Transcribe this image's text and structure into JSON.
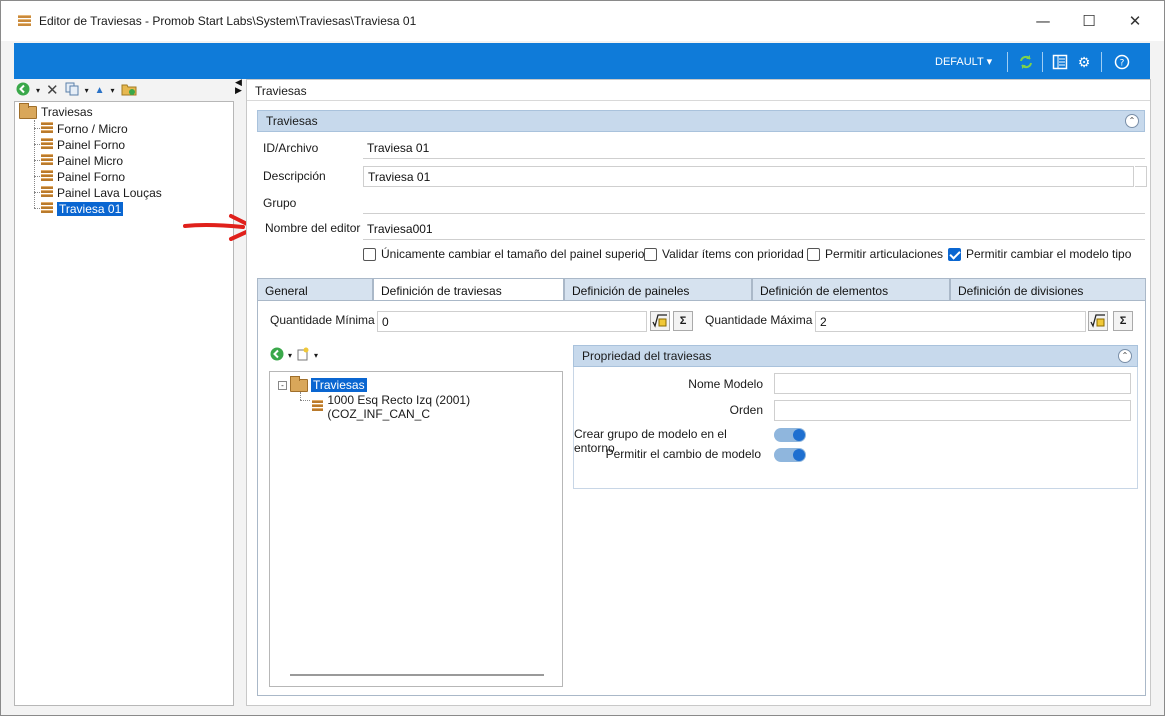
{
  "window": {
    "title": "Editor de Traviesas - Promob Start Labs\\System\\Traviesas\\Traviesa 01",
    "minimize": "—",
    "maximize": "☐",
    "close": "✕"
  },
  "toolbar": {
    "profile": "DEFAULT",
    "icons": [
      "refresh-icon",
      "layout-icon",
      "settings-icon",
      "help-icon"
    ]
  },
  "left_toolbar": {
    "icons": [
      "back-icon",
      "delete-icon",
      "copy-icon",
      "up-icon",
      "folder-icon"
    ]
  },
  "left_tree": {
    "root": "Traviesas",
    "items": [
      "Forno / Micro",
      "Painel Forno",
      "Painel Micro",
      "Painel Forno",
      "Painel Lava Louças",
      "Traviesa 01"
    ],
    "selected_index": 5
  },
  "content": {
    "breadcrumb": "Traviesas",
    "group_title": "Traviesas",
    "fields": {
      "id_label": "ID/Archivo",
      "id_value": "Traviesa 01",
      "desc_label": "Descripción",
      "desc_value": "Traviesa 01",
      "group_label": "Grupo",
      "group_value": "",
      "editor_label": "Nombre del editor",
      "editor_value": "Traviesa001"
    },
    "checkboxes": [
      {
        "label": "Únicamente cambiar el tamaño del painel superior",
        "checked": false
      },
      {
        "label": "Validar ítems con prioridad",
        "checked": false
      },
      {
        "label": "Permitir articulaciones",
        "checked": false
      },
      {
        "label": "Permitir cambiar el modelo tipo",
        "checked": true
      }
    ]
  },
  "tabs": [
    "General",
    "Definición de traviesas",
    "Definición de paineles",
    "Definición de elementos",
    "Definición de divisiones"
  ],
  "active_tab": 1,
  "definition": {
    "min_label": "Quantidade Mínima",
    "min_value": "0",
    "max_label": "Quantidade Máxima",
    "max_value": "2",
    "sum_symbol": "Σ",
    "tree_root": "Traviesas",
    "tree_item": "1000 Esq Recto Izq (2001) (COZ_INF_CAN_C",
    "props_title": "Propriedad del traviesas",
    "model_name_label": "Nome Modelo",
    "model_name_value": "",
    "order_label": "Orden",
    "order_value": "",
    "create_group_label": "Crear grupo de modelo en el entorno",
    "create_group_on": true,
    "allow_change_label": "Permitir el cambio de modelo",
    "allow_change_on": true
  },
  "colors": {
    "accent": "#0f7bd9",
    "selection": "#0a66d1",
    "group_header": "#c7d9ec",
    "annotation_arrow": "#e0201b"
  }
}
